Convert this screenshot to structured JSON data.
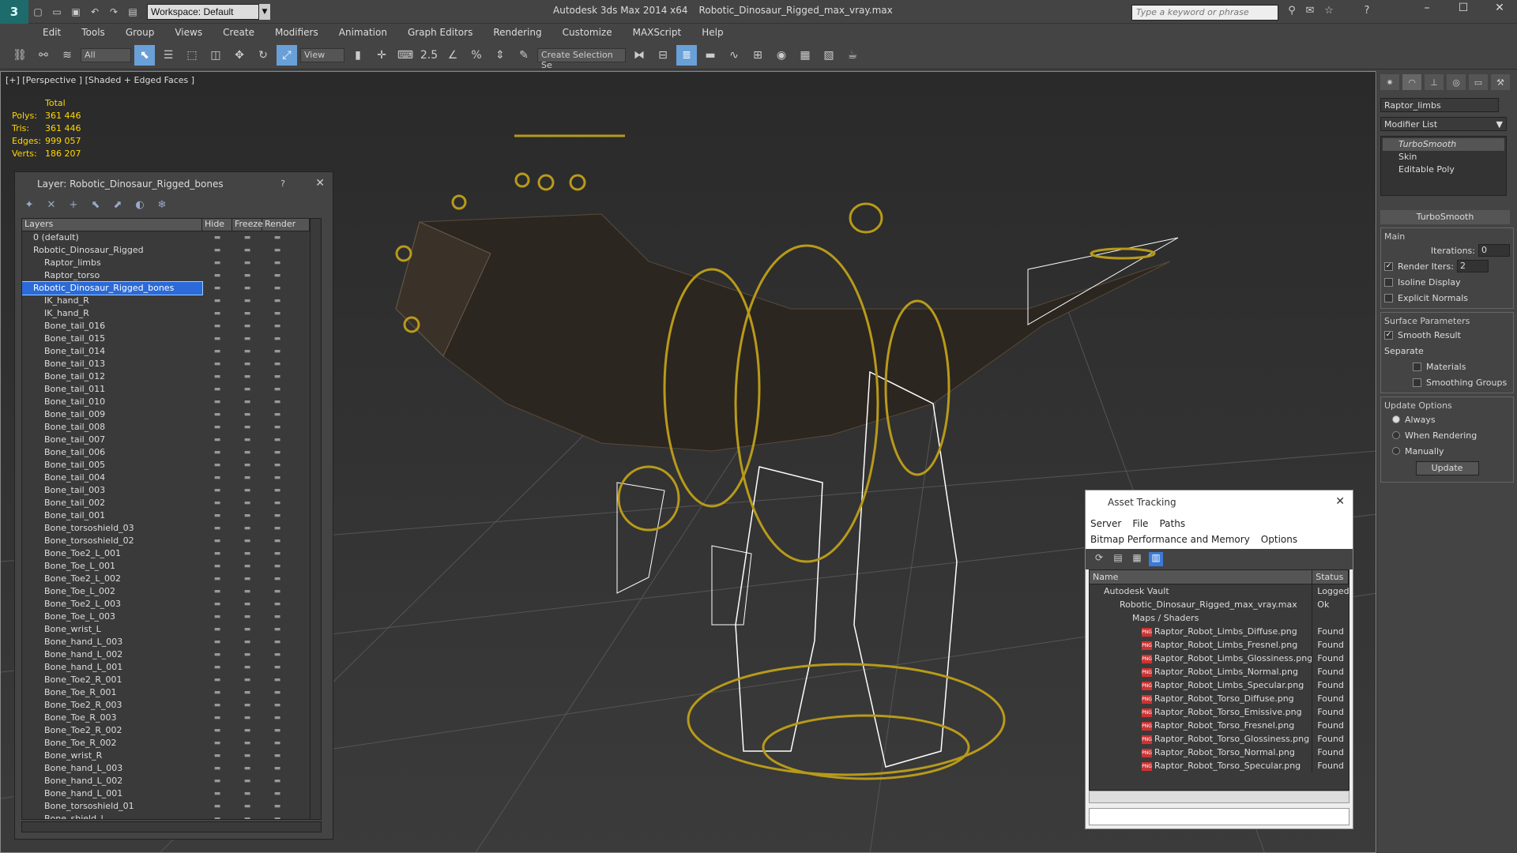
{
  "title": {
    "app": "Autodesk 3ds Max  2014 x64",
    "file": "Robotic_Dinosaur_Rigged_max_vray.max",
    "workspace": "Workspace: Default",
    "search_placeholder": "Type a keyword or phrase"
  },
  "menu": [
    "Edit",
    "Tools",
    "Group",
    "Views",
    "Create",
    "Modifiers",
    "Animation",
    "Graph Editors",
    "Rendering",
    "Customize",
    "MAXScript",
    "Help"
  ],
  "toolbar": {
    "filter": "All",
    "coord": "View",
    "selset": "Create Selection Se",
    "snap": "2.5"
  },
  "viewport": {
    "label": "[+] [Perspective ] [Shaded + Edged Faces ]",
    "stats_head": "Total",
    "stats": [
      {
        "k": "Polys:",
        "v": "361 446"
      },
      {
        "k": "Tris:",
        "v": "361 446"
      },
      {
        "k": "Edges:",
        "v": "999 057"
      },
      {
        "k": "Verts:",
        "v": "186 207"
      }
    ]
  },
  "command_panel": {
    "object": "Raptor_limbs",
    "modlist": "Modifier List",
    "stack": [
      "TurboSmooth",
      "Skin",
      "Editable Poly"
    ],
    "rollout": "TurboSmooth",
    "main": "Main",
    "iterations_label": "Iterations:",
    "iterations": "0",
    "render_iters_label": "Render Iters:",
    "render_iters": "2",
    "isoline": "Isoline Display",
    "explicit": "Explicit Normals",
    "surface": "Surface Parameters",
    "smooth_result": "Smooth Result",
    "separate": "Separate",
    "materials": "Materials",
    "smoothing_groups": "Smoothing Groups",
    "update_options": "Update Options",
    "always": "Always",
    "when_rendering": "When Rendering",
    "manually": "Manually",
    "update": "Update"
  },
  "layer_dialog": {
    "title": "Layer: Robotic_Dinosaur_Rigged_bones",
    "help": "?",
    "headers": [
      "Layers",
      "Hide",
      "Freeze",
      "Render"
    ],
    "rows": [
      "0 (default)",
      "Robotic_Dinosaur_Rigged",
      "Raptor_limbs",
      "Raptor_torso",
      "Robotic_Dinosaur_Rigged_bones",
      "IK_hand_R",
      "IK_hand_R",
      "Bone_tail_016",
      "Bone_tail_015",
      "Bone_tail_014",
      "Bone_tail_013",
      "Bone_tail_012",
      "Bone_tail_011",
      "Bone_tail_010",
      "Bone_tail_009",
      "Bone_tail_008",
      "Bone_tail_007",
      "Bone_tail_006",
      "Bone_tail_005",
      "Bone_tail_004",
      "Bone_tail_003",
      "Bone_tail_002",
      "Bone_tail_001",
      "Bone_torsoshield_03",
      "Bone_torsoshield_02",
      "Bone_Toe2_L_001",
      "Bone_Toe_L_001",
      "Bone_Toe2_L_002",
      "Bone_Toe_L_002",
      "Bone_Toe2_L_003",
      "Bone_Toe_L_003",
      "Bone_wrist_L",
      "Bone_hand_L_003",
      "Bone_hand_L_002",
      "Bone_hand_L_001",
      "Bone_Toe2_R_001",
      "Bone_Toe_R_001",
      "Bone_Toe2_R_003",
      "Bone_Toe_R_003",
      "Bone_Toe2_R_002",
      "Bone_Toe_R_002",
      "Bone_wrist_R",
      "Bone_hand_L_003",
      "Bone_hand_L_002",
      "Bone_hand_L_001",
      "Bone_torsoshield_01",
      "Bone_shield_l"
    ]
  },
  "asset_dialog": {
    "title": "Asset Tracking",
    "menu": [
      "Server",
      "File",
      "Paths",
      "Bitmap Performance and Memory",
      "Options"
    ],
    "headers": [
      "Name",
      "Status"
    ],
    "rows": [
      {
        "n": "Autodesk Vault",
        "s": "Logged O"
      },
      {
        "n": "Robotic_Dinosaur_Rigged_max_vray.max",
        "s": "Ok"
      },
      {
        "n": "Maps / Shaders",
        "s": ""
      },
      {
        "n": "Raptor_Robot_Limbs_Diffuse.png",
        "s": "Found"
      },
      {
        "n": "Raptor_Robot_Limbs_Fresnel.png",
        "s": "Found"
      },
      {
        "n": "Raptor_Robot_Limbs_Glossiness.png",
        "s": "Found"
      },
      {
        "n": "Raptor_Robot_Limbs_Normal.png",
        "s": "Found"
      },
      {
        "n": "Raptor_Robot_Limbs_Specular.png",
        "s": "Found"
      },
      {
        "n": "Raptor_Robot_Torso_Diffuse.png",
        "s": "Found"
      },
      {
        "n": "Raptor_Robot_Torso_Emissive.png",
        "s": "Found"
      },
      {
        "n": "Raptor_Robot_Torso_Fresnel.png",
        "s": "Found"
      },
      {
        "n": "Raptor_Robot_Torso_Glossiness.png",
        "s": "Found"
      },
      {
        "n": "Raptor_Robot_Torso_Normal.png",
        "s": "Found"
      },
      {
        "n": "Raptor_Robot_Torso_Specular.png",
        "s": "Found"
      }
    ]
  }
}
